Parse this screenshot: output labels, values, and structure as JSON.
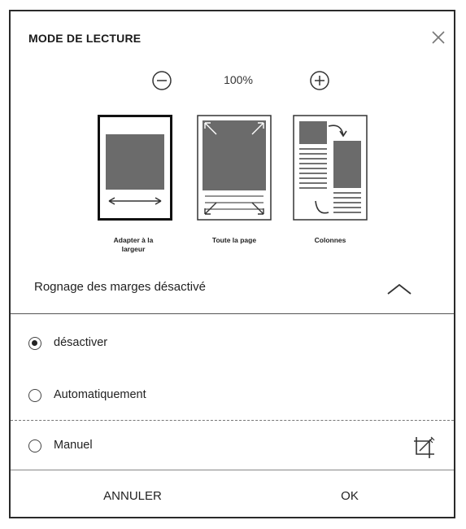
{
  "dialog": {
    "title": "MODE DE LECTURE",
    "close_icon": "close-icon"
  },
  "zoom": {
    "value": "100%",
    "minus_icon": "zoom-out-icon",
    "plus_icon": "zoom-in-icon"
  },
  "modes": [
    {
      "label_line1": "Adapter à la",
      "label_line2": "largeur",
      "icon": "fit-width-icon",
      "selected": true
    },
    {
      "label_line1": "Toute la page",
      "label_line2": "",
      "icon": "full-page-icon",
      "selected": false
    },
    {
      "label_line1": "Colonnes",
      "label_line2": "",
      "icon": "columns-icon",
      "selected": false
    }
  ],
  "cropping": {
    "title": "Rognage des marges désactivé",
    "toggle_icon": "chevron-up-icon",
    "options": [
      {
        "label": "désactiver",
        "checked": true
      },
      {
        "label": "Automatiquement",
        "checked": false
      },
      {
        "label": "Manuel",
        "checked": false
      }
    ],
    "manual_icon": "crop-edit-icon"
  },
  "footer": {
    "cancel_label": "ANNULER",
    "ok_label": "OK"
  }
}
